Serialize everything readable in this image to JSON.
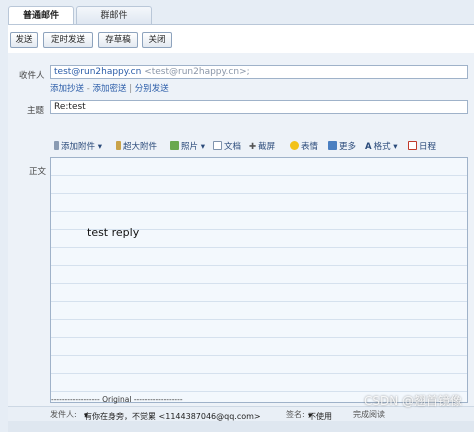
{
  "tabs": [
    {
      "label": "普通邮件",
      "active": true
    },
    {
      "label": "群邮件",
      "active": false
    }
  ],
  "toolbar": {
    "send": "发送",
    "scheduled_send": "定时发送",
    "save_draft": "存草稿",
    "close": "关闭"
  },
  "recipients": {
    "label": "收件人",
    "address": "test@run2happy.cn",
    "full": "<test@run2happy.cn>;",
    "add_cc": "添加抄送",
    "add_bcc": "添加密送",
    "separate_send": "分别发送",
    "dash": "-",
    "bar": "|"
  },
  "subject": {
    "label": "主题",
    "value": "Re:test"
  },
  "editor_toolbar": {
    "attachment": "添加附件",
    "large_attachment": "超大附件",
    "photo": "照片",
    "document": "文档",
    "screenshot": "截屏",
    "emoji": "表情",
    "more": "更多",
    "format": "格式",
    "calendar": "日程"
  },
  "body": {
    "label": "正文",
    "text": "test reply",
    "original_marker": "------------------ Original ------------------"
  },
  "footer": {
    "sender_label": "发件人:",
    "sender_value": "有你在身旁，不觉累 <1144387046@qq.com>",
    "signature_label": "签名:",
    "signature_value": "不使用",
    "arrow": "▾",
    "extra": "完成阅读"
  },
  "watermark": "CSDN @翘首镜像",
  "colors": {
    "accent": "#2a5ca8",
    "panel_bg": "#edf2f8",
    "editor_bg": "#f3f8fd"
  }
}
